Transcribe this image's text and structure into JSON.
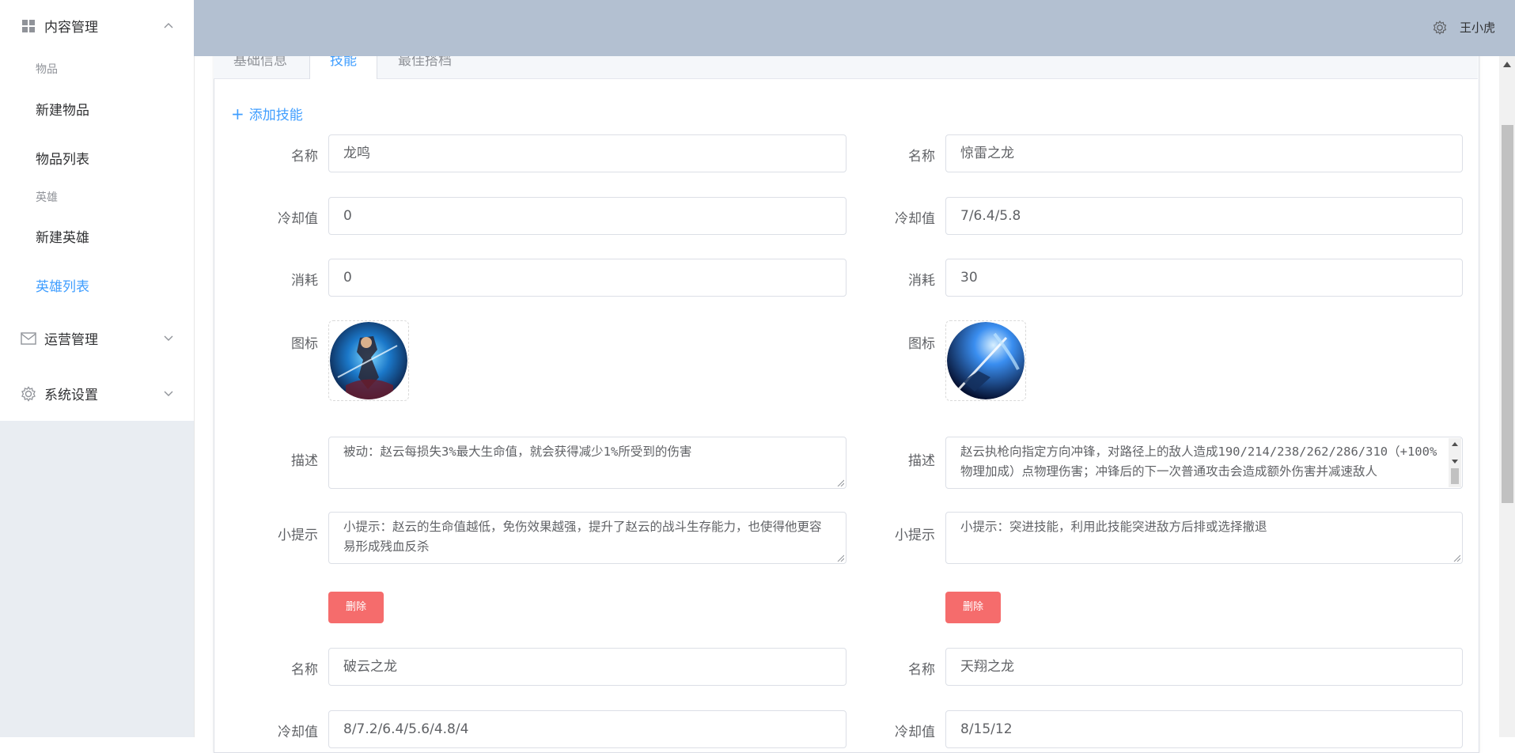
{
  "sidebar": {
    "content_mgmt": "内容管理",
    "group_items": "物品",
    "item_new": "新建物品",
    "item_list": "物品列表",
    "group_heroes": "英雄",
    "hero_new": "新建英雄",
    "hero_list": "英雄列表",
    "ops_mgmt": "运营管理",
    "settings": "系统设置"
  },
  "header": {
    "user": "王小虎"
  },
  "tabs": [
    "基础信息",
    "技能",
    "最佳搭档"
  ],
  "add_skill": "添加技能",
  "labels": {
    "name": "名称",
    "cooldown": "冷却值",
    "cost": "消耗",
    "icon": "图标",
    "desc": "描述",
    "tips": "小提示",
    "delete": "删除"
  },
  "skills": [
    {
      "name": "龙鸣",
      "cooldown": "0",
      "cost": "0",
      "desc": "被动：赵云每损失3%最大生命值，就会获得减少1%所受到的伤害",
      "tips": "小提示：赵云的生命值越低，免伤效果越强，提升了赵云的战斗生存能力，也使得他更容易形成残血反杀"
    },
    {
      "name": "惊雷之龙",
      "cooldown": "7/6.4/5.8",
      "cost": "30",
      "desc": "赵云执枪向指定方向冲锋，对路径上的敌人造成190/214/238/262/286/310（+100%物理加成）点物理伤害；冲锋后的下一次普通攻击会造成额外伤害并减速敌人",
      "tips": "小提示：突进技能，利用此技能突进敌方后排或选择撤退"
    },
    {
      "name": "破云之龙",
      "cooldown": "8/7.2/6.4/5.6/4.8/4"
    },
    {
      "name": "天翔之龙",
      "cooldown": "8/15/12"
    }
  ],
  "colors": {
    "accent": "#409eff",
    "danger": "#f56c6c",
    "header_bg": "#b3c0d1"
  }
}
